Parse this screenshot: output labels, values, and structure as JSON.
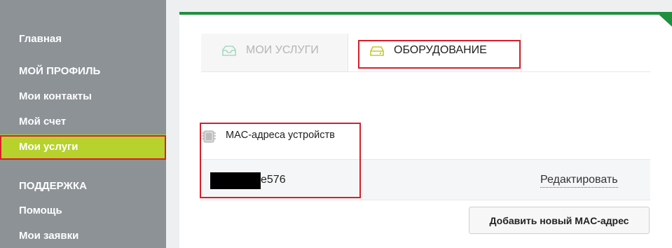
{
  "sidebar": {
    "items": [
      {
        "label": "Главная"
      },
      {
        "label": "МОЙ ПРОФИЛЬ"
      },
      {
        "label": "Мои контакты"
      },
      {
        "label": "Мой счет"
      },
      {
        "label": "Мои услуги"
      },
      {
        "label": "ПОДДЕРЖКА"
      },
      {
        "label": "Помощь"
      },
      {
        "label": "Мои заявки"
      }
    ]
  },
  "tabs": [
    {
      "label": "МОИ УСЛУГИ",
      "icon": "inbox-icon"
    },
    {
      "label": "ОБОРУДОВАНИЕ",
      "icon": "hard-drive-icon"
    }
  ],
  "equipment": {
    "section_title": "MAC-адреса устройств",
    "section_icon": "chip-icon",
    "mac_visible_suffix": "e576",
    "edit_label": "Редактировать",
    "add_button_label": "Добавить новый MAC-адрес"
  },
  "colors": {
    "sidebar_bg": "#8c9296",
    "active_item_bg": "#b7d22c",
    "accent_green": "#1f8f3d",
    "highlight_red": "#d6202b"
  }
}
